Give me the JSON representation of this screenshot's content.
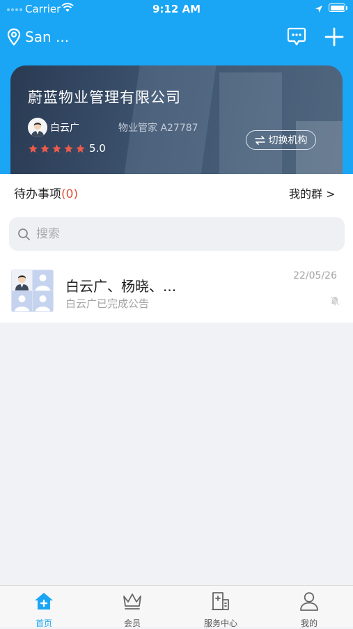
{
  "status_bar": {
    "carrier": "Carrier",
    "time": "9:12 AM"
  },
  "header": {
    "location": "San ..."
  },
  "company_card": {
    "company_name": "蔚蓝物业管理有限公司",
    "user_name": "白云广",
    "role_code": "物业管家 A27787",
    "star_count": 5,
    "rating": "5.0",
    "switch_label": "切换机构"
  },
  "todo": {
    "label": "待办事项",
    "count": "(0)"
  },
  "my_groups": "我的群 >",
  "search": {
    "placeholder": "搜索"
  },
  "chats": [
    {
      "title": "白云广、杨晓、...",
      "subtitle": "白云广已完成公告",
      "date": "22/05/26"
    }
  ],
  "tabs": [
    {
      "label": "首页",
      "icon": "home-icon",
      "active": true
    },
    {
      "label": "会员",
      "icon": "crown-icon",
      "active": false
    },
    {
      "label": "服务中心",
      "icon": "service-center-icon",
      "active": false
    },
    {
      "label": "我的",
      "icon": "person-icon",
      "active": false
    }
  ],
  "colors": {
    "primary": "#1aa6f5",
    "star": "#ee5a4a",
    "todo_count": "#e0533c"
  }
}
